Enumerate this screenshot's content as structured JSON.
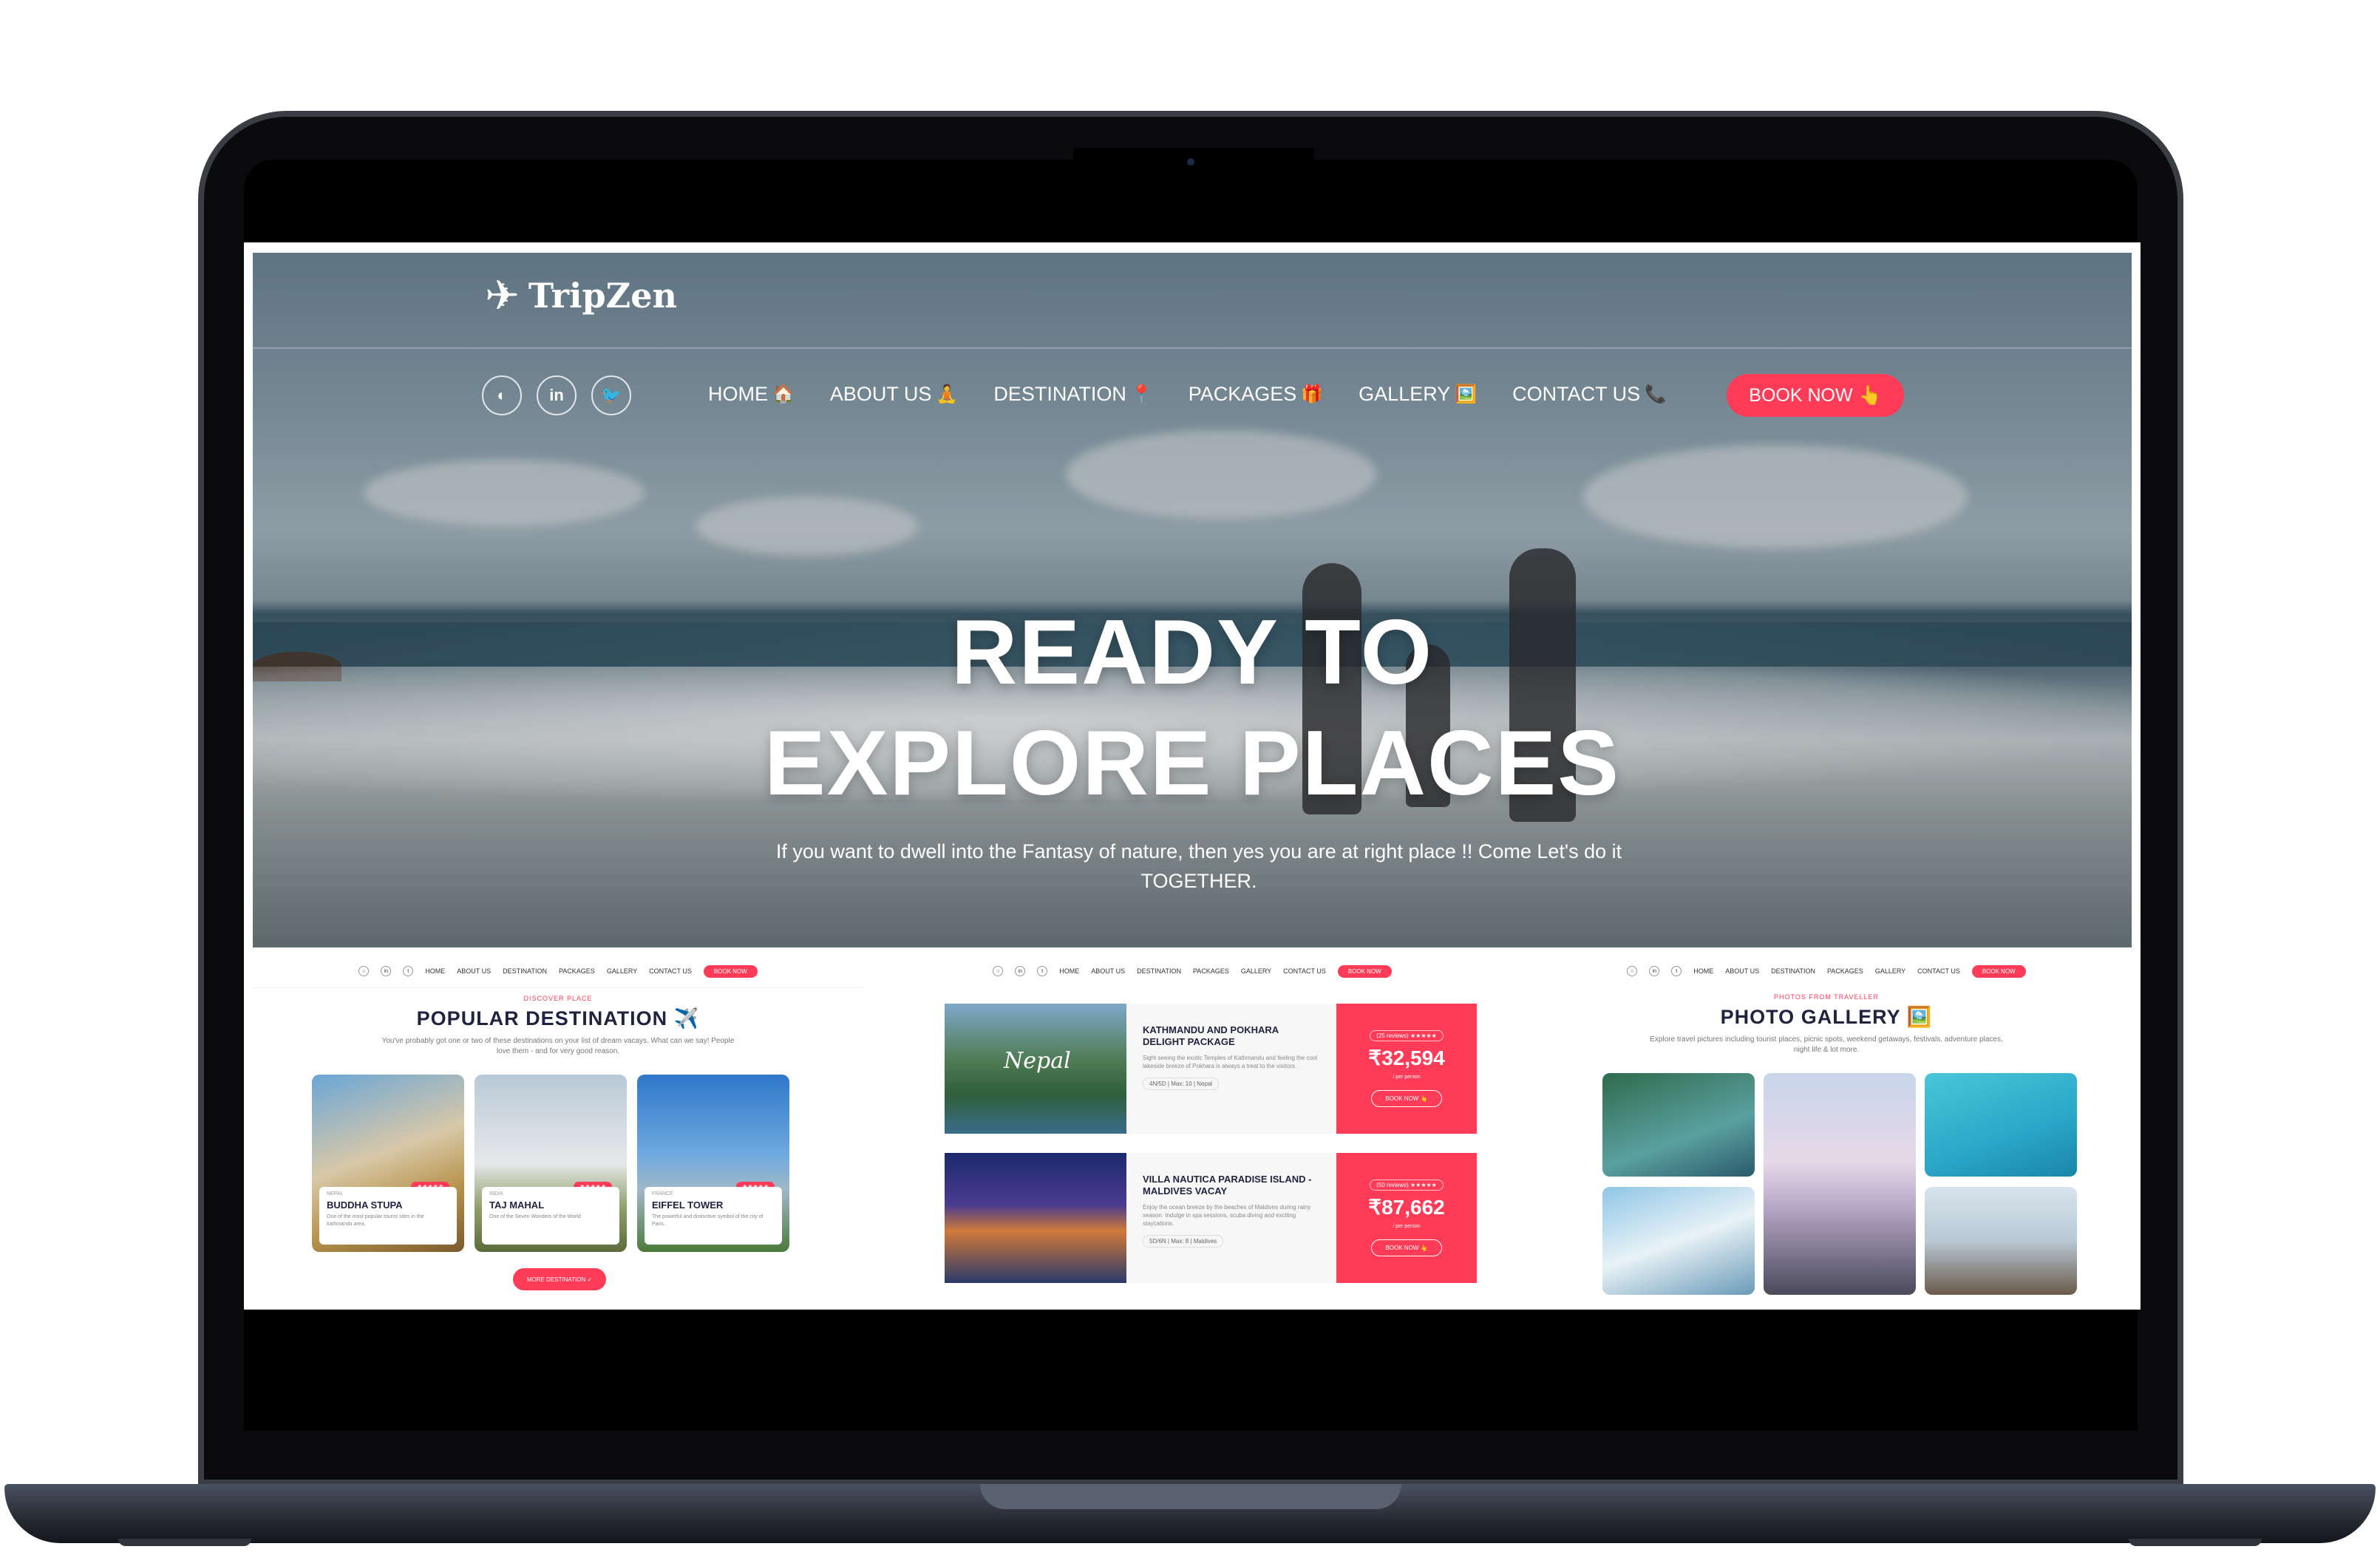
{
  "site": {
    "logo_text": "TripZen",
    "socials": [
      "github-icon",
      "linkedin-icon",
      "twitter-icon"
    ],
    "nav": [
      {
        "label": "HOME",
        "emoji": "🏠"
      },
      {
        "label": "ABOUT US",
        "emoji": "🧘"
      },
      {
        "label": "DESTINATION",
        "emoji": "📍"
      },
      {
        "label": "PACKAGES",
        "emoji": "🎁"
      },
      {
        "label": "GALLERY",
        "emoji": "🖼️"
      },
      {
        "label": "CONTACT US",
        "emoji": "📞"
      }
    ],
    "book_now": "BOOK NOW",
    "book_now_emoji": "👆",
    "accent": "#ff3b57"
  },
  "hero": {
    "title_line1": "READY TO",
    "title_line2": "EXPLORE PLACES",
    "subtitle": "If you want to dwell into the Fantasy of nature, then yes you are at right place !! Come Let's do it TOGETHER."
  },
  "destinations_preview": {
    "eyebrow": "DISCOVER PLACE",
    "title": "POPULAR DESTINATION ✈️",
    "description": "You've probably got one or two of these destinations on your list of dream vacays. What can we say! People love them - and for very good reason.",
    "cards": [
      {
        "country": "NEPAL",
        "name": "BUDDHA STUPA",
        "desc": "One of the most popular tourist sites in the kathmandu area.",
        "stars": "★★★★★"
      },
      {
        "country": "INDIA",
        "name": "TAJ MAHAL",
        "desc": "One of the Seven Wonders of the World",
        "stars": "★★★★★"
      },
      {
        "country": "FRANCE",
        "name": "EIFFEL TOWER",
        "desc": "The powerful and distinctive symbol of the city of Paris.",
        "stars": "★★★★★"
      }
    ],
    "more_button": "MORE DESTINATION ✓"
  },
  "packages_preview": {
    "packages": [
      {
        "name": "KATHMANDU AND POKHARA DELIGHT PACKAGE",
        "desc": "Sight seeing the exotic Temples of Kathmandu and feeling the cool lakeside breeze of Pokhara is always a treat to the visitors.",
        "meta": "4N/5D | Max: 10 | Nepal",
        "reviews": "(25 reviews)",
        "stars": "★★★★★",
        "price": "₹32,594",
        "per": "/ per person",
        "button": "BOOK NOW 👆",
        "image_caption": "Nepal"
      },
      {
        "name": "VILLA NAUTICA PARADISE ISLAND - MALDIVES VACAY",
        "desc": "Enjoy the ocean breeze by the beaches of Maldives during rainy season. Indulge in spa sessions, scuba diving and exciting staycations.",
        "meta": "5D/6N | Max: 8 | Maldives",
        "reviews": "(50 reviews)",
        "stars": "★★★★★",
        "price": "₹87,662",
        "per": "/ per person",
        "button": "BOOK NOW 👆"
      }
    ]
  },
  "gallery_preview": {
    "eyebrow": "PHOTOS FROM TRAVELLER",
    "title": "PHOTO GALLERY 🖼️",
    "description": "Explore travel pictures including tourist places, picnic spots, weekend getaways, festivals, adventure places, night life & lot more."
  }
}
